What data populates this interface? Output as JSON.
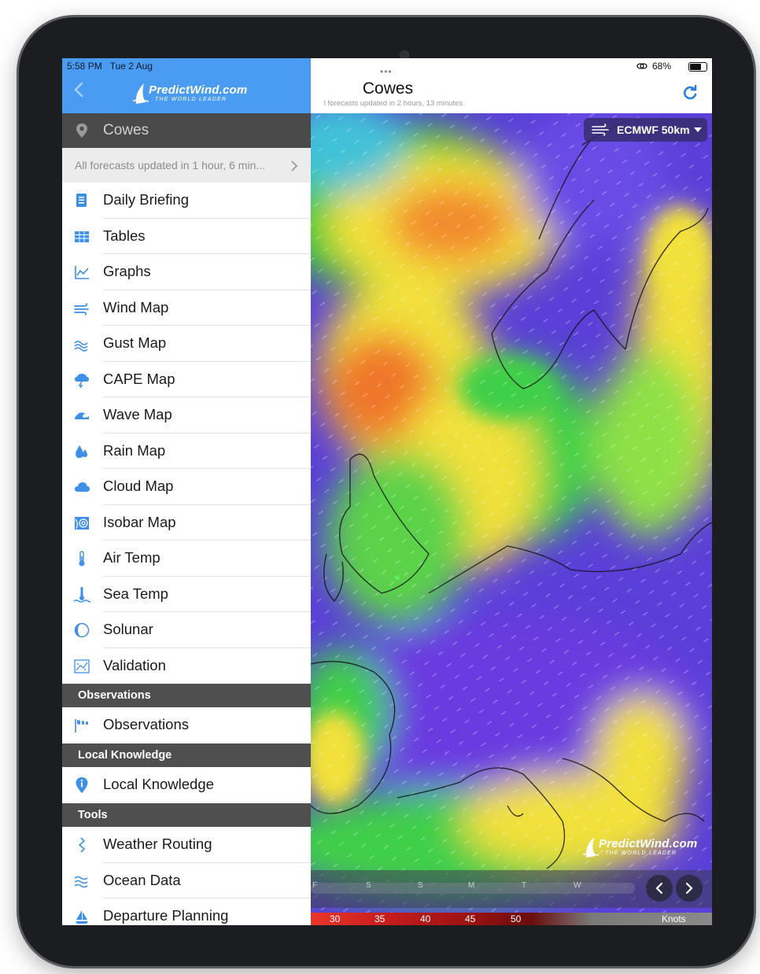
{
  "status": {
    "time": "5:58 PM",
    "date": "Tue 2 Aug",
    "battery": "68%",
    "dots": "•••"
  },
  "sidebar": {
    "logo_main": "PredictWind.com",
    "logo_sub": "THE WORLD LEADER",
    "location": "Cowes",
    "updated": "All forecasts updated in 1 hour, 6 min...",
    "items": [
      {
        "label": "Daily Briefing",
        "icon": "document-icon"
      },
      {
        "label": "Tables",
        "icon": "table-icon"
      },
      {
        "label": "Graphs",
        "icon": "graph-icon"
      },
      {
        "label": "Wind Map",
        "icon": "wind-icon"
      },
      {
        "label": "Gust Map",
        "icon": "gust-icon"
      },
      {
        "label": "CAPE Map",
        "icon": "storm-cloud-icon"
      },
      {
        "label": "Wave Map",
        "icon": "wave-icon"
      },
      {
        "label": "Rain Map",
        "icon": "rain-drop-icon"
      },
      {
        "label": "Cloud Map",
        "icon": "cloud-icon"
      },
      {
        "label": "Isobar Map",
        "icon": "isobar-icon"
      },
      {
        "label": "Air Temp",
        "icon": "thermometer-icon"
      },
      {
        "label": "Sea Temp",
        "icon": "sea-thermometer-icon"
      },
      {
        "label": "Solunar",
        "icon": "moon-icon"
      },
      {
        "label": "Validation",
        "icon": "scatter-chart-icon"
      }
    ],
    "sections": {
      "observations": {
        "title": "Observations",
        "item": "Observations"
      },
      "local_knowledge": {
        "title": "Local Knowledge",
        "item": "Local Knowledge"
      },
      "tools": {
        "title": "Tools",
        "items": [
          "Weather Routing",
          "Ocean Data",
          "Departure Planning"
        ]
      }
    }
  },
  "main": {
    "title": "Cowes",
    "subtitle": "l forecasts updated in 2 hours, 13 minutes",
    "model": "ECMWF 50km",
    "map_logo_main": "PredictWind.com",
    "map_logo_sub": "THE WORLD LEADER",
    "timeline_days": [
      "F",
      "S",
      "S",
      "M",
      "T",
      "W"
    ],
    "legend": {
      "values": [
        "30",
        "35",
        "40",
        "45",
        "50"
      ],
      "unit": "Knots"
    }
  },
  "colors": {
    "accent": "#4a9cf2",
    "icon_blue": "#3d8fe8",
    "section_bg": "#4f4f4f",
    "location_bg": "#4a4a4a"
  }
}
